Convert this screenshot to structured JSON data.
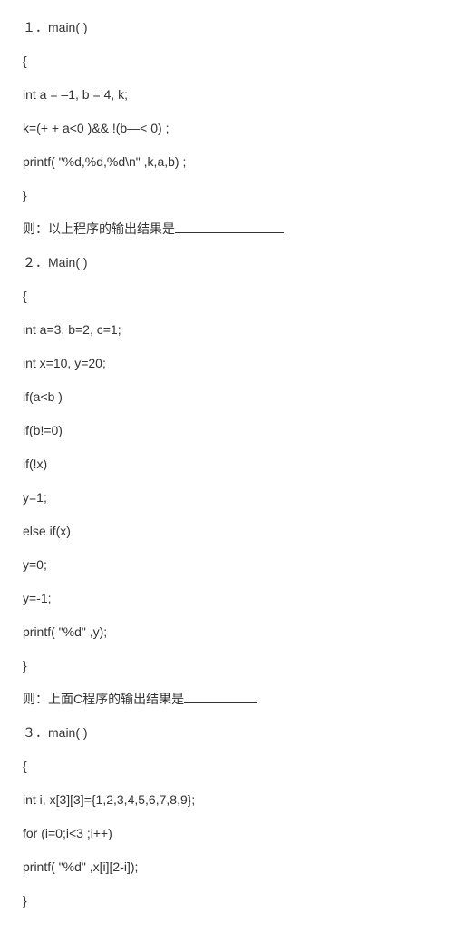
{
  "lines": [
    "１．main( )",
    "{",
    "int a = –1, b = 4, k;",
    "k=(+ + a<0 )&& !(b—< 0) ;",
    "printf( \"%d,%d,%d\\n\" ,k,a,b) ;",
    "}"
  ],
  "question1": "则：以上程序的输出结果是",
  "lines2": [
    "２．Main( )",
    "{",
    "int a=3, b=2, c=1;",
    "int x=10, y=20;",
    "if(a<b )",
    "if(b!=0)",
    "if(!x)",
    "y=1;",
    "else if(x)",
    "y=0;",
    "y=-1;",
    "printf( \"%d\" ,y);",
    "}"
  ],
  "question2": "则：上面C程序的输出结果是",
  "lines3": [
    "３．main( )",
    "{",
    "int i, x[3][3]={1,2,3,4,5,6,7,8,9};",
    "for (i=0;i<3 ;i++)",
    "printf( \"%d\" ,x[i][2-i]);",
    "}"
  ]
}
